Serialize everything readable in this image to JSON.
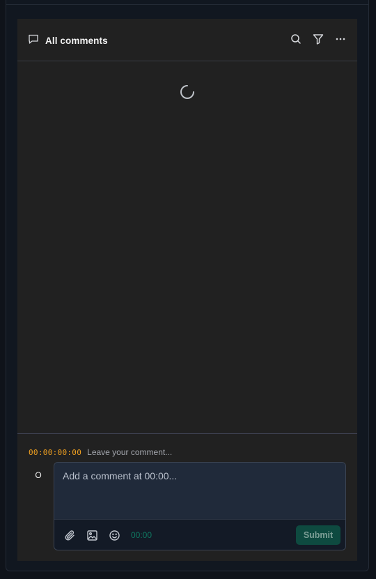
{
  "header": {
    "title": "All comments",
    "icons": {
      "title": "comment-icon",
      "search": "search-icon",
      "filter": "filter-icon",
      "more": "more-icon"
    }
  },
  "comment_list": {
    "loading": true,
    "indicator": "loading-spinner"
  },
  "composer": {
    "timecode": "00:00:00:00",
    "hint": "Leave your comment...",
    "avatar_initial": "O",
    "input_value": "",
    "input_placeholder": "Add a comment at 00:00...",
    "toolbar": {
      "time": "00:00",
      "icons": [
        "paperclip-icon",
        "image-icon",
        "emoji-icon"
      ]
    },
    "submit_label": "Submit"
  },
  "colors": {
    "background": "#0f131a",
    "panel": "#212121",
    "timecode": "#f0a020",
    "input_background": "#202a3a",
    "toolbar_background": "#131a26",
    "submit_background": "#0e4a40",
    "toolbar_time": "#0f7a62"
  }
}
